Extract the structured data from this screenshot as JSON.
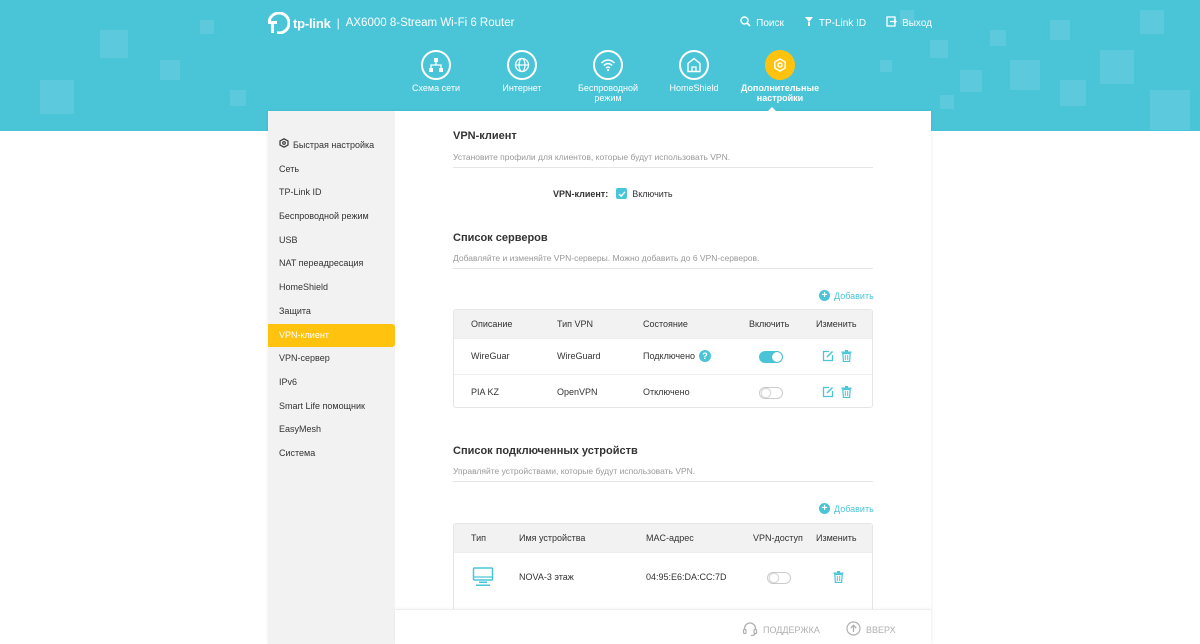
{
  "brand": {
    "logo_text": "tp-link",
    "separator": "|",
    "model": "AX6000 8-Stream Wi-Fi 6 Router"
  },
  "top_links": [
    {
      "label": "Поиск",
      "icon": "search-icon"
    },
    {
      "label": "TP-Link ID",
      "icon": "tplink-id-icon"
    },
    {
      "label": "Выход",
      "icon": "logout-icon"
    }
  ],
  "nav_tabs": [
    {
      "label": "Схема сети",
      "icon": "network-map-icon",
      "active": false
    },
    {
      "label": "Интернет",
      "icon": "globe-icon",
      "active": false
    },
    {
      "label": "Беспроводной режим",
      "icon": "wifi-icon",
      "active": false
    },
    {
      "label": "HomeShield",
      "icon": "homeshield-icon",
      "active": false
    },
    {
      "label": "Дополнительные настройки",
      "icon": "gear-icon",
      "active": true
    }
  ],
  "sidebar": {
    "items": [
      {
        "label": "Быстрая настройка",
        "icon": "quick-setup-icon"
      },
      {
        "label": "Сеть"
      },
      {
        "label": "TP-Link ID"
      },
      {
        "label": "Беспроводной режим"
      },
      {
        "label": "USB"
      },
      {
        "label": "NAT переадресация"
      },
      {
        "label": "HomeShield"
      },
      {
        "label": "Защита"
      },
      {
        "label": "VPN-клиент",
        "active": true
      },
      {
        "label": "VPN-сервер"
      },
      {
        "label": "IPv6"
      },
      {
        "label": "Smart Life помощник"
      },
      {
        "label": "EasyMesh"
      },
      {
        "label": "Система"
      }
    ]
  },
  "vpn_client": {
    "title": "VPN-клиент",
    "description": "Установите профили для клиентов, которые будут использовать VPN.",
    "enable_label": "VPN-клиент:",
    "enable_value": "Включить",
    "enabled": true
  },
  "servers": {
    "title": "Список серверов",
    "description": "Добавляйте и изменяйте VPN-серверы. Можно добавить до 6 VPN-серверов.",
    "add_label": "Добавить",
    "columns": [
      "Описание",
      "Тип VPN",
      "Состояние",
      "Включить",
      "Изменить"
    ],
    "rows": [
      {
        "description": "WireGuar",
        "type": "WireGuard",
        "status": "Подключено",
        "enabled": true
      },
      {
        "description": "PIA KZ",
        "type": "OpenVPN",
        "status": "Отключено",
        "enabled": false
      }
    ]
  },
  "devices": {
    "title": "Список подключенных устройств",
    "description": "Управляйте устройствами, которые будут использовать VPN.",
    "add_label": "Добавить",
    "columns": [
      "Тип",
      "Имя устройства",
      "MAC-адрес",
      "VPN-доступ",
      "Изменить"
    ],
    "rows": [
      {
        "type_icon": "computer-icon",
        "name": "NOVA-3 этаж",
        "mac": "04:95:E6:DA:CC:7D",
        "vpn_access": false
      }
    ]
  },
  "footer": {
    "support_label": "ПОДДЕРЖКА",
    "top_label": "ВВЕРХ"
  },
  "colors": {
    "accent": "#4ac5d8",
    "active": "#ffc20e",
    "sidebar_bg": "#f2f2f2"
  }
}
